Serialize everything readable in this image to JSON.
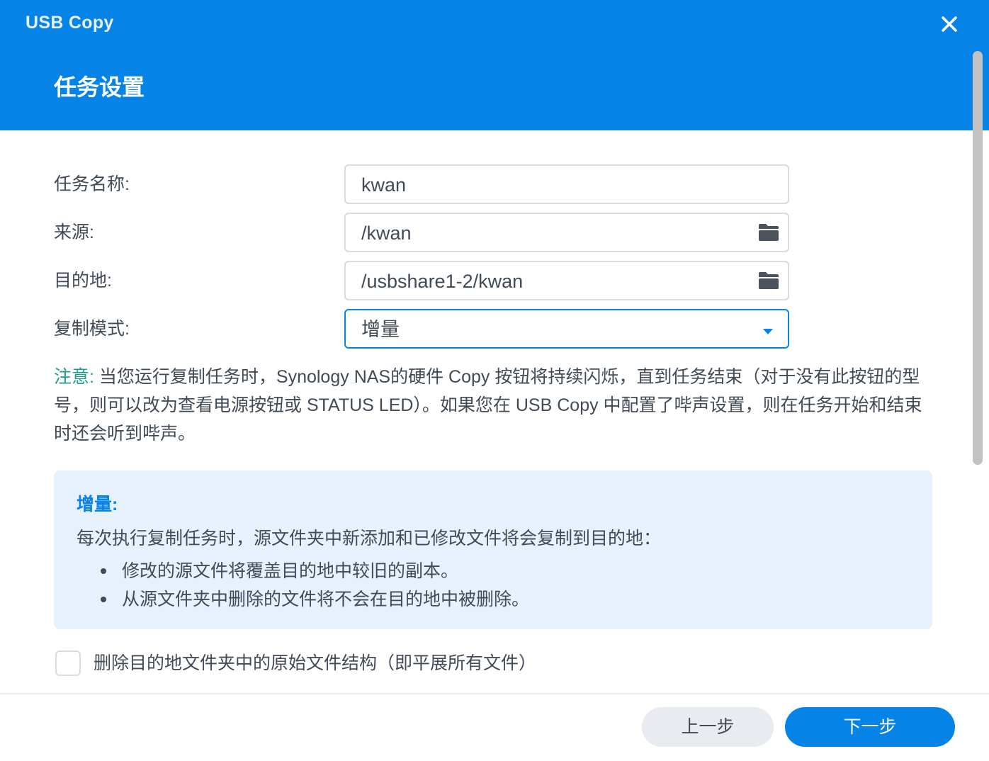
{
  "window": {
    "title": "USB Copy",
    "close_icon": "close-icon"
  },
  "wizard": {
    "step_title": "任务设置"
  },
  "form": {
    "task_name": {
      "label": "任务名称:",
      "value": "kwan"
    },
    "source": {
      "label": "来源:",
      "value": "/kwan",
      "icon": "folder-icon"
    },
    "destination": {
      "label": "目的地:",
      "value": "/usbshare1-2/kwan",
      "icon": "folder-icon"
    },
    "copy_mode": {
      "label": "复制模式:",
      "value": "增量",
      "icon": "chevron-down-icon"
    }
  },
  "note": {
    "label": "注意:",
    "text": " 当您运行复制任务时，Synology NAS的硬件 Copy 按钮将持续闪烁，直到任务结束（对于没有此按钮的型号，则可以改为查看电源按钮或 STATUS LED）。如果您在 USB Copy 中配置了哔声设置，则在任务开始和结束时还会听到哔声。"
  },
  "info_box": {
    "title": "增量:",
    "description": "每次执行复制任务时，源文件夹中新添加和已修改文件将会复制到目的地：",
    "items": [
      "修改的源文件将覆盖目的地中较旧的副本。",
      "从源文件夹中删除的文件将不会在目的地中被删除。"
    ]
  },
  "options": {
    "flatten_label": "删除目的地文件夹中的原始文件结构（即平展所有文件）",
    "flatten_checked": false
  },
  "footer": {
    "prev_label": "上一步",
    "next_label": "下一步"
  },
  "colors": {
    "header_bg": "#0583e7",
    "accent": "#0583e7",
    "note_label": "#1a9f8e",
    "info_bg": "#e6f1fc",
    "text": "#414b55"
  }
}
